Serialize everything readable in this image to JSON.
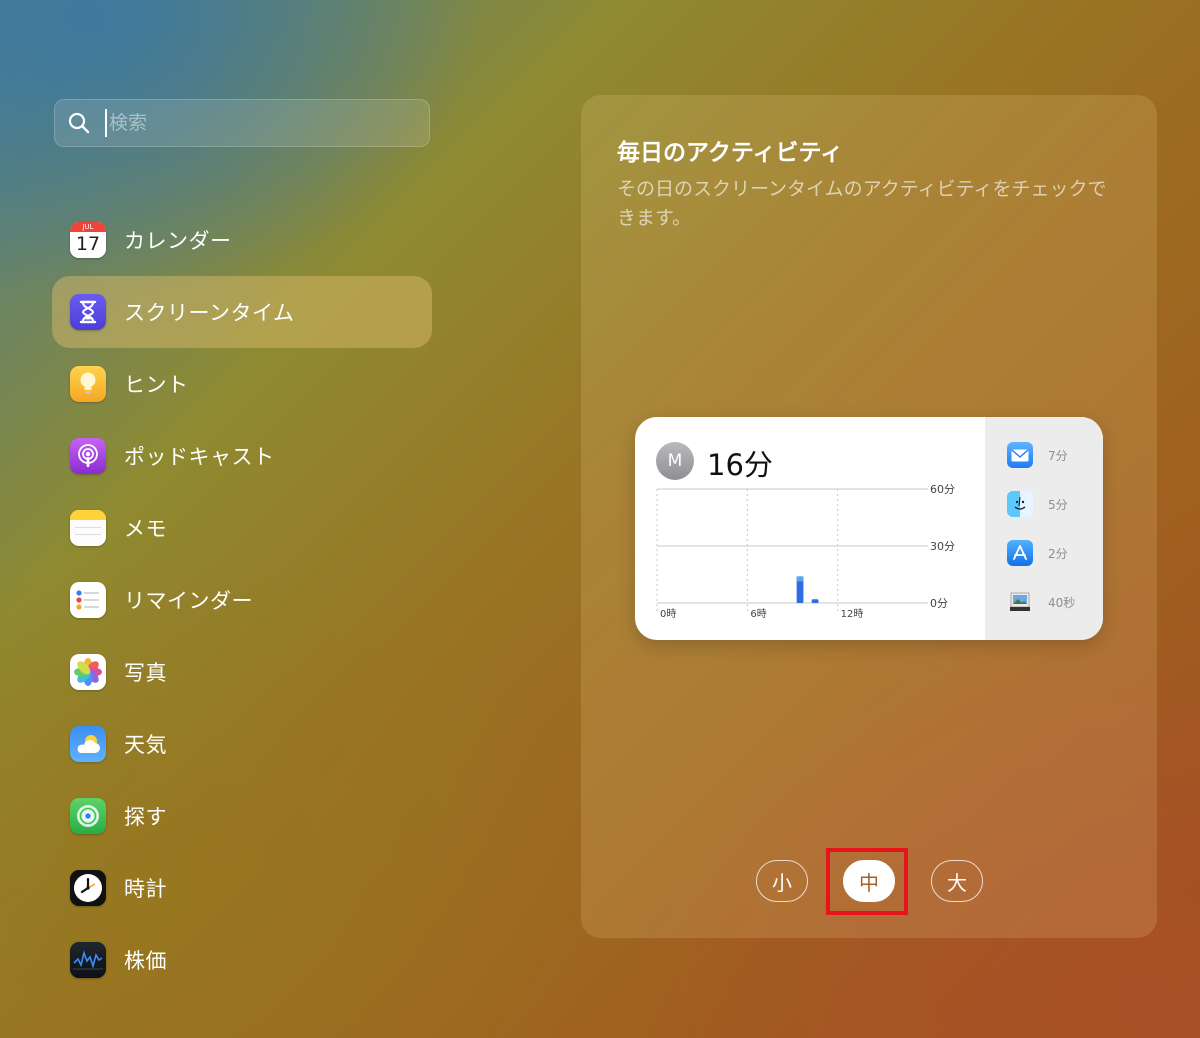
{
  "search": {
    "placeholder": "検索"
  },
  "sidebar": {
    "items": [
      {
        "label": "カレンダー",
        "icon": "calendar-icon",
        "calendar_month": "JUL",
        "calendar_day": "17"
      },
      {
        "label": "スクリーンタイム",
        "icon": "screen-time-icon",
        "selected": true
      },
      {
        "label": "ヒント",
        "icon": "tips-icon"
      },
      {
        "label": "ポッドキャスト",
        "icon": "podcasts-icon"
      },
      {
        "label": "メモ",
        "icon": "notes-icon"
      },
      {
        "label": "リマインダー",
        "icon": "reminders-icon"
      },
      {
        "label": "写真",
        "icon": "photos-icon"
      },
      {
        "label": "天気",
        "icon": "weather-icon"
      },
      {
        "label": "探す",
        "icon": "find-my-icon"
      },
      {
        "label": "時計",
        "icon": "clock-icon"
      },
      {
        "label": "株価",
        "icon": "stocks-icon"
      }
    ]
  },
  "panel": {
    "title": "毎日のアクティビティ",
    "description": "その日のスクリーンタイムのアクティビティをチェックできます。"
  },
  "widget": {
    "avatar_initial": "M",
    "total": "16分",
    "apps": [
      {
        "icon": "mail-icon",
        "duration": "7分"
      },
      {
        "icon": "finder-icon",
        "duration": "5分"
      },
      {
        "icon": "app-store-icon",
        "duration": "2分"
      },
      {
        "icon": "preview-icon",
        "duration": "40秒"
      }
    ]
  },
  "chart_data": {
    "type": "bar",
    "y_tick_labels": [
      "60分",
      "30分",
      "0分"
    ],
    "x_tick_labels": [
      "0時",
      "6時",
      "12時"
    ],
    "ylim": [
      0,
      60
    ],
    "xlim": [
      0,
      18
    ],
    "bars": [
      {
        "hour": 9.5,
        "minutes": 14
      },
      {
        "hour": 10.5,
        "minutes": 2
      }
    ],
    "colors": {
      "bar": "#2f6ee0",
      "bar_top": "#5aa7ee",
      "grid": "#c8c8c8"
    }
  },
  "size_selector": {
    "options": [
      "小",
      "中",
      "大"
    ],
    "selected": "中"
  },
  "colors": {
    "highlight": "#e8141c",
    "selected_row": "#c9a55b"
  }
}
